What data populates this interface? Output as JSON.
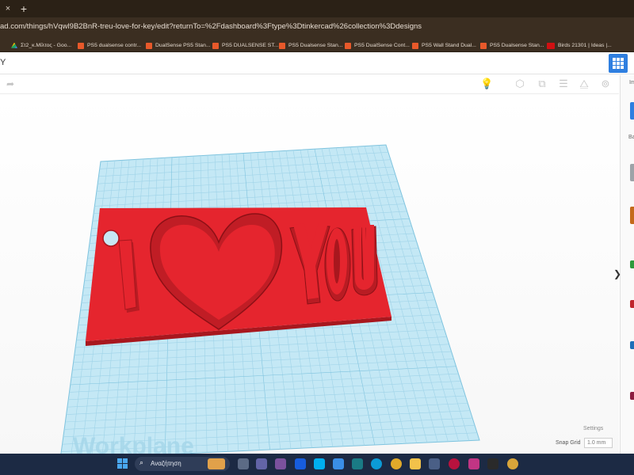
{
  "browser": {
    "tab_close": "×",
    "new_tab": "+",
    "url": "ad.com/things/hVqwl9B2BnR-treu-love-for-key/edit?returnTo=%2Fdashboard%3Ftype%3Dtinkercad%26collection%3Ddesigns",
    "bookmarks": [
      {
        "label": "Στ2_κ.Μίλτος - Goo...",
        "icon": "drive-icon"
      },
      {
        "label": "PS5 dualsense contr...",
        "icon": "site-icon"
      },
      {
        "label": "DualSense PS5 Stan...",
        "icon": "site-icon"
      },
      {
        "label": "PS5 DUALSENSE ST...",
        "icon": "site-icon"
      },
      {
        "label": "PS5 Dualsense Stan...",
        "icon": "site-icon"
      },
      {
        "label": "PS5 DualSense Cont...",
        "icon": "site-icon"
      },
      {
        "label": "PS5 Wall Stand Dual...",
        "icon": "site-icon"
      },
      {
        "label": "PS5 Dualsense Stan...",
        "icon": "site-icon"
      },
      {
        "label": "Birds 21301 | Ideas |...",
        "icon": "lego-icon"
      }
    ]
  },
  "tinkercad": {
    "title": "Y",
    "workplane_label": "Workplane",
    "settings_label": "Settings",
    "snap_grid_label": "Snap Grid",
    "snap_grid_value": "1.0 mm",
    "right_panel": {
      "label_top": "Im",
      "label_basic": "Ba",
      "collapse_icon": "❯"
    },
    "model_text_left": "I",
    "model_text_right": "YOU",
    "colors": {
      "model": "#e5252e",
      "grid": "#bfe4f2",
      "grid_line": "#8fcbe2"
    }
  },
  "taskbar": {
    "search_placeholder": "Αναζήτηση",
    "apps": [
      "file-explorer-icon",
      "meet-icon",
      "teams-icon",
      "viber-icon",
      "bitwarden-icon",
      "skype-icon",
      "photos-icon",
      "clipchamp-icon",
      "edge-icon",
      "chrome-icon",
      "files-icon",
      "store-icon",
      "maps-icon",
      "opera-icon",
      "instagram-icon",
      "epic-games-icon",
      "chrome-profile-icon"
    ]
  }
}
